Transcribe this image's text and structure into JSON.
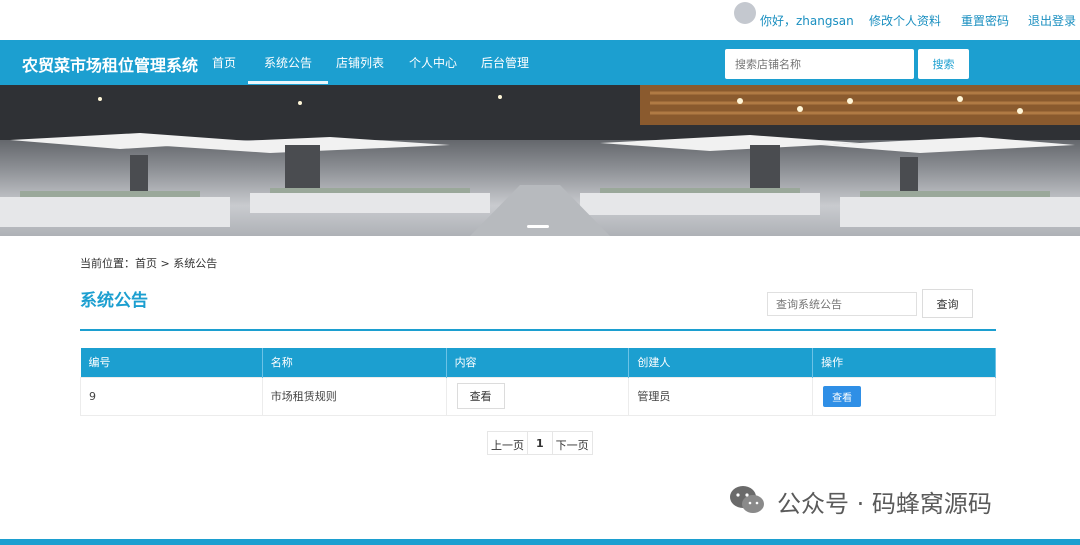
{
  "userbar": {
    "greeting": "你好，zhangsan",
    "edit_profile": "修改个人资料",
    "reset_password": "重置密码",
    "logout": "退出登录"
  },
  "nav": {
    "brand": "农贸菜市场租位管理系统",
    "items": [
      "首页",
      "系统公告",
      "店铺列表",
      "个人中心",
      "后台管理"
    ],
    "active": "系统公告",
    "search_placeholder": "搜索店铺名称",
    "search_button": "搜索"
  },
  "breadcrumb": "当前位置：首页 > 系统公告",
  "page": {
    "title": "系统公告",
    "query_placeholder": "查询系统公告",
    "query_button": "查询"
  },
  "table": {
    "headers": [
      "编号",
      "名称",
      "内容",
      "创建人",
      "操作"
    ],
    "rows": [
      {
        "id": "9",
        "name": "市场租赁规则",
        "content_button": "查看",
        "creator": "管理员",
        "action_button": "查看"
      }
    ]
  },
  "pagination": {
    "prev": "上一页",
    "current": "1",
    "next": "下一页"
  },
  "watermark": "公众号 · 码蜂窝源码",
  "colors": {
    "primary": "#1c9fd0",
    "action_blue": "#2f8fe6"
  }
}
